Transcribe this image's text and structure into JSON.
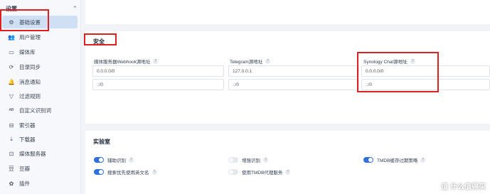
{
  "sidebar": {
    "title": "设置",
    "items": [
      {
        "label": "基础设置",
        "icon": "gear-icon",
        "glyph": "⚙",
        "active": true
      },
      {
        "label": "用户管理",
        "icon": "users-icon",
        "glyph": "👥"
      },
      {
        "label": "媒体库",
        "icon": "folder-icon",
        "glyph": "▭"
      },
      {
        "label": "目录同步",
        "icon": "sync-icon",
        "glyph": "⟳"
      },
      {
        "label": "消息通知",
        "icon": "bell-icon",
        "glyph": "🔔"
      },
      {
        "label": "过滤规则",
        "icon": "filter-icon",
        "glyph": "▽"
      },
      {
        "label": "自定义识别词",
        "icon": "regex-icon",
        "glyph": "ᴬᴮ"
      },
      {
        "label": "索引器",
        "icon": "indexer-icon",
        "glyph": "⊟"
      },
      {
        "label": "下载器",
        "icon": "download-icon",
        "glyph": "⤓"
      },
      {
        "label": "媒体服务器",
        "icon": "server-icon",
        "glyph": "⊡"
      },
      {
        "label": "豆瓣",
        "icon": "douban-icon",
        "glyph": "豆"
      },
      {
        "label": "插件",
        "icon": "plugin-icon",
        "glyph": "✿"
      }
    ]
  },
  "security": {
    "title": "安全",
    "fields": [
      {
        "label": "媒体服务器Webhook源地址",
        "ipv4": "0.0.0.0/0",
        "ipv6": "::/0"
      },
      {
        "label": "Telegram源地址",
        "ipv4": "127.0.0.1",
        "ipv6": "::/0"
      },
      {
        "label": "Synology Chat源地址",
        "ipv4": "0.0.0.0/0",
        "ipv6": "::/0"
      }
    ]
  },
  "lab": {
    "title": "实验室",
    "toggles": [
      {
        "label": "辅助识别",
        "on": true
      },
      {
        "label": "增强识别",
        "on": false
      },
      {
        "label": "TMDB缓存过期策略",
        "on": true
      },
      {
        "label": "搜索优先使用英文名",
        "on": true
      },
      {
        "label": "使用TMDB代理服务",
        "on": false
      }
    ]
  },
  "watermark": "值 什么值得买"
}
